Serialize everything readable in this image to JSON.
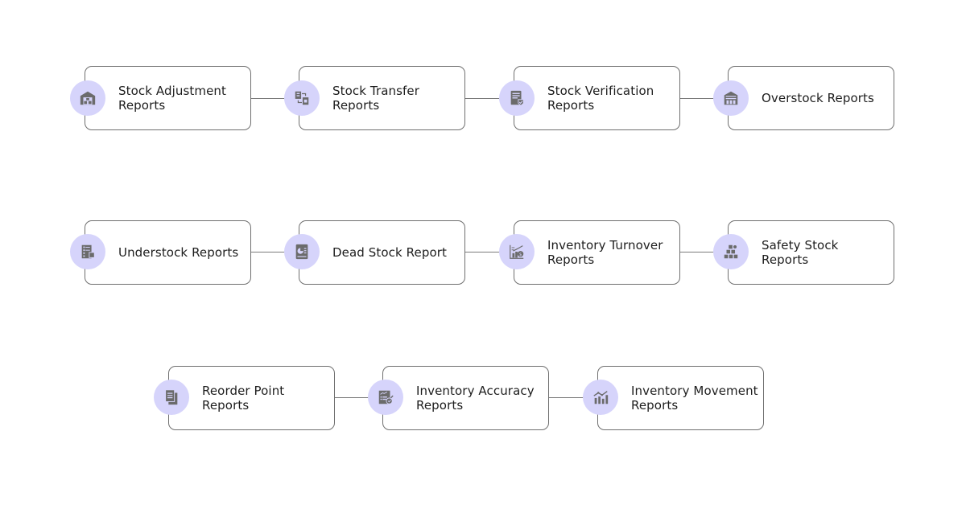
{
  "diagram": {
    "type": "process-flow",
    "colors": {
      "icon_circle": "#d6d4fb",
      "icon_glyph": "#6b6b6b",
      "card_border": "#6f6f6f",
      "text": "#1d1d1d"
    },
    "rows": [
      {
        "nodes": [
          {
            "label": "Stock Adjustment Reports",
            "icon": "warehouse-icon"
          },
          {
            "label": "Stock Transfer Reports",
            "icon": "transfer-documents-icon"
          },
          {
            "label": "Stock Verification Reports",
            "icon": "verified-document-icon"
          },
          {
            "label": "Overstock Reports",
            "icon": "building-icon"
          }
        ]
      },
      {
        "nodes": [
          {
            "label": "Understock Reports",
            "icon": "checklist-boxes-icon"
          },
          {
            "label": "Dead Stock Report",
            "icon": "pie-report-icon"
          },
          {
            "label": "Inventory Turnover Reports",
            "icon": "trend-money-icon"
          },
          {
            "label": "Safety Stock Reports",
            "icon": "stacked-boxes-icon"
          }
        ]
      },
      {
        "nodes": [
          {
            "label": "Reorder Point Reports",
            "icon": "copy-documents-icon"
          },
          {
            "label": "Inventory Accuracy Reports",
            "icon": "clipboard-check-icon"
          },
          {
            "label": "Inventory Movement Reports",
            "icon": "bar-growth-icon"
          }
        ]
      }
    ]
  }
}
